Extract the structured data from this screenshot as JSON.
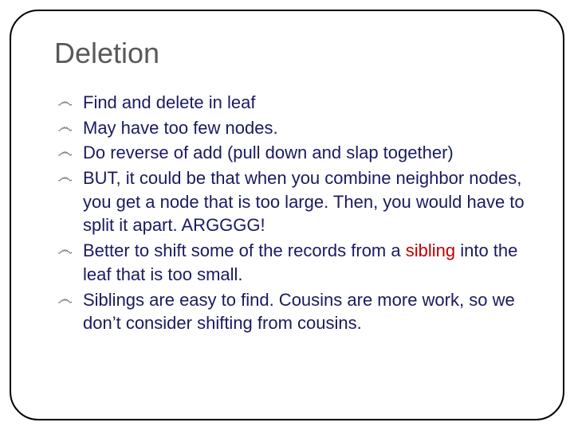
{
  "title": "Deletion",
  "bullet_glyph": "෴",
  "items": [
    {
      "text": "Find and delete in leaf"
    },
    {
      "text": "May have too few nodes."
    },
    {
      "text": "Do reverse of add (pull down and slap together)"
    },
    {
      "text": "BUT, it could be that when you combine neighbor nodes, you get a node that is too large.  Then, you would have to split it apart.  ARGGGG!"
    },
    {
      "prefix": "Better to shift some of the records from a ",
      "highlight": "sibling",
      "suffix": " into the leaf that is too small."
    },
    {
      "text": "Siblings are easy to find.  Cousins are more work, so we don’t consider shifting from cousins."
    }
  ]
}
